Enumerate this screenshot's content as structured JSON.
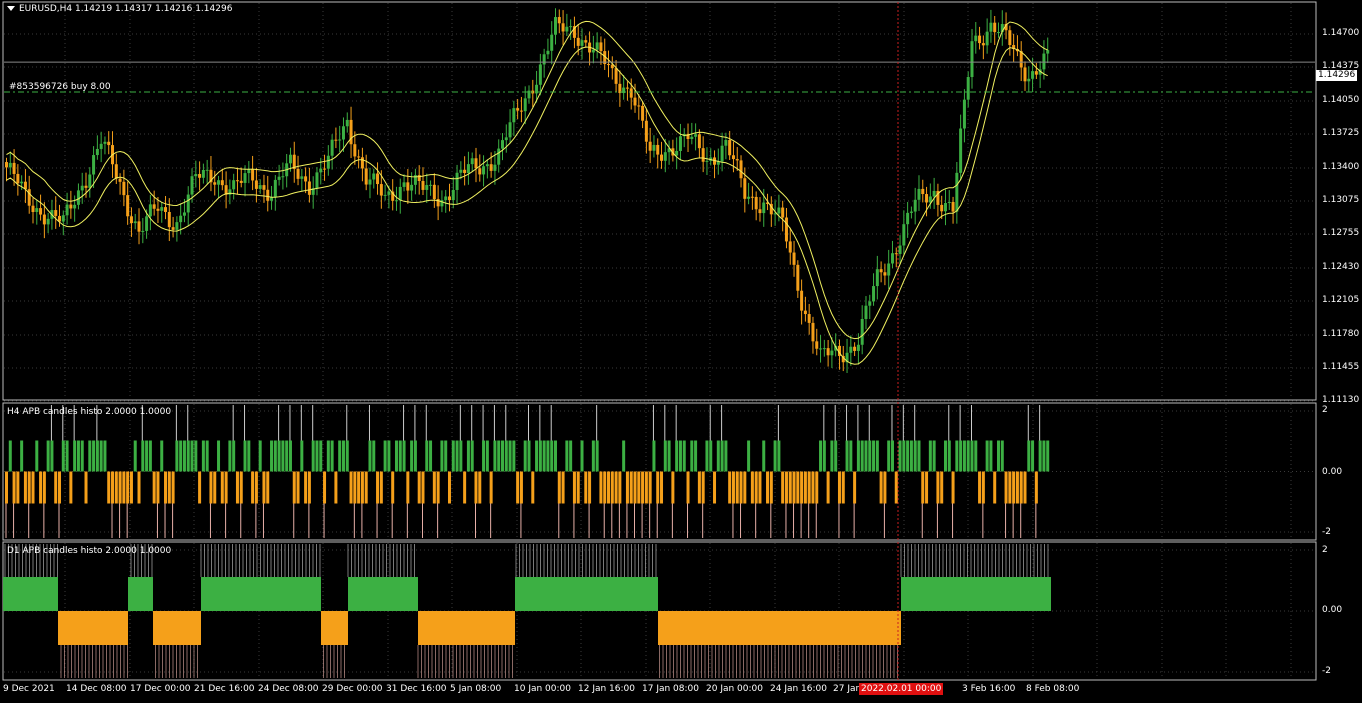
{
  "main": {
    "symbol_header": "EURUSD,H4  1.14219 1.14317 1.14216 1.14296",
    "order_line_label": "#853596726 buy 8.00",
    "current_price": "1.14296",
    "price_labels": [
      "1.14700",
      "1.14375",
      "1.14050",
      "1.13725",
      "1.13400",
      "1.13075",
      "1.12755",
      "1.12430",
      "1.12105",
      "1.11780",
      "1.11455",
      "1.11130"
    ]
  },
  "indicator1": {
    "label": "H4 APB candles histo 2.0000 1.0000",
    "scale_labels": [
      "2",
      "0.00",
      "-2"
    ]
  },
  "indicator2": {
    "label": "D1 APB candles histo 2.0000 1.0000",
    "scale_labels": [
      "2",
      "0.00",
      "-2"
    ]
  },
  "time_axis": {
    "labels": [
      "9 Dec 2021",
      "14 Dec 08:00",
      "17 Dec 00:00",
      "21 Dec 16:00",
      "24 Dec 08:00",
      "29 Dec 00:00",
      "31 Dec 16:00",
      "5 Jan 08:00",
      "10 Jan 00:00",
      "12 Jan 16:00",
      "17 Jan 08:00",
      "20 Jan 00:00",
      "24 Jan 16:00",
      "27 Jan",
      "3 Feb 16:00",
      "8 Feb 08:00"
    ],
    "highlighted": "2022.02.01 00:00"
  },
  "colors": {
    "bull": "#3cb043",
    "bear": "#f5a01a",
    "envelope": "#f0f060",
    "grid": "#3a3a3a",
    "cursor_line": "#c82020",
    "order_line": "#3cb043"
  },
  "chart_data": {
    "type": "candlestick",
    "symbol": "EURUSD",
    "timeframe": "H4",
    "ohlc_last": {
      "open": 1.14219,
      "high": 1.14317,
      "low": 1.14216,
      "close": 1.14296
    },
    "ylim": [
      1.1113,
      1.1486
    ],
    "close_path": [
      [
        0,
        1.1331
      ],
      [
        5,
        1.1302
      ],
      [
        10,
        1.129
      ],
      [
        15,
        1.1276
      ],
      [
        20,
        1.1318
      ],
      [
        25,
        1.1354
      ],
      [
        30,
        1.1315
      ],
      [
        35,
        1.1272
      ],
      [
        40,
        1.129
      ],
      [
        45,
        1.1282
      ],
      [
        50,
        1.1318
      ],
      [
        55,
        1.1325
      ],
      [
        60,
        1.131
      ],
      [
        65,
        1.1321
      ],
      [
        70,
        1.131
      ],
      [
        75,
        1.133
      ],
      [
        80,
        1.1318
      ],
      [
        85,
        1.1335
      ],
      [
        90,
        1.1375
      ],
      [
        95,
        1.132
      ],
      [
        100,
        1.13
      ],
      [
        105,
        1.132
      ],
      [
        110,
        1.1308
      ],
      [
        115,
        1.1304
      ],
      [
        120,
        1.1322
      ],
      [
        125,
        1.1332
      ],
      [
        130,
        1.1345
      ],
      [
        135,
        1.138
      ],
      [
        140,
        1.142
      ],
      [
        145,
        1.1458
      ],
      [
        150,
        1.1462
      ],
      [
        155,
        1.144
      ],
      [
        160,
        1.1418
      ],
      [
        165,
        1.1405
      ],
      [
        170,
        1.134
      ],
      [
        175,
        1.1352
      ],
      [
        180,
        1.1356
      ],
      [
        185,
        1.134
      ],
      [
        190,
        1.1352
      ],
      [
        195,
        1.1305
      ],
      [
        200,
        1.13
      ],
      [
        205,
        1.1275
      ],
      [
        210,
        1.121
      ],
      [
        215,
        1.115
      ],
      [
        220,
        1.1158
      ],
      [
        225,
        1.117
      ],
      [
        230,
        1.1225
      ],
      [
        235,
        1.126
      ],
      [
        240,
        1.1295
      ],
      [
        245,
        1.131
      ],
      [
        250,
        1.129
      ],
      [
        255,
        1.145
      ],
      [
        260,
        1.1465
      ],
      [
        265,
        1.1445
      ],
      [
        270,
        1.142
      ],
      [
        275,
        1.143
      ]
    ]
  }
}
